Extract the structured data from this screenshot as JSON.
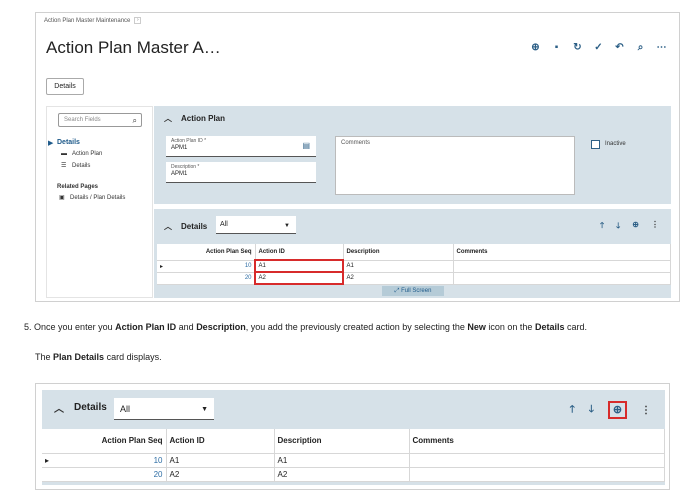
{
  "top_screenshot": {
    "breadcrumb": "Action Plan Master Maintenance",
    "breadcrumb_sep": "›",
    "title": "Action Plan Master A…",
    "details_button": "Details",
    "search_placeholder": "Search Fields",
    "nav": {
      "heading": "Details",
      "items": [
        "Action Plan",
        "Details"
      ],
      "related_heading": "Related Pages",
      "related_items": [
        "Details / Plan Details"
      ]
    },
    "action_plan_card": {
      "title": "Action Plan",
      "plan_id_label": "Action Plan ID *",
      "plan_id_value": "APM1",
      "description_label": "Description *",
      "description_value": "APM1",
      "comments_label": "Comments",
      "inactive_label": "Inactive"
    },
    "details_card": {
      "title": "Details",
      "dropdown_value": "All",
      "columns": [
        "Action Plan Seq",
        "Action ID",
        "Description",
        "Comments"
      ],
      "rows": [
        {
          "seq": "10",
          "action_id": "A1",
          "description": "A1",
          "comments": ""
        },
        {
          "seq": "20",
          "action_id": "A2",
          "description": "A2",
          "comments": ""
        }
      ],
      "full_screen": "Full Screen"
    }
  },
  "instruction": {
    "number": "5.",
    "part1": "Once you enter you",
    "bold1": "Action Plan ID",
    "part2": "and",
    "bold2": "Description",
    "part3": ", you add the previously created action by selecting the",
    "bold3": "New",
    "part4": "icon on the",
    "bold4": "Details",
    "part5": "card.",
    "sub_part1": "The",
    "sub_bold": "Plan Details",
    "sub_part2": "card displays."
  },
  "bottom_screenshot": {
    "title": "Details",
    "dropdown_value": "All",
    "columns": [
      "Action Plan Seq",
      "Action ID",
      "Description",
      "Comments"
    ],
    "rows": [
      {
        "seq": "10",
        "action_id": "A1",
        "description": "A1",
        "comments": ""
      },
      {
        "seq": "20",
        "action_id": "A2",
        "description": "A2",
        "comments": ""
      }
    ]
  },
  "colors": {
    "accent": "#2c5f86",
    "card_bg": "#d6e1e8",
    "highlight": "#d72b2b",
    "link": "#2e6da4"
  }
}
